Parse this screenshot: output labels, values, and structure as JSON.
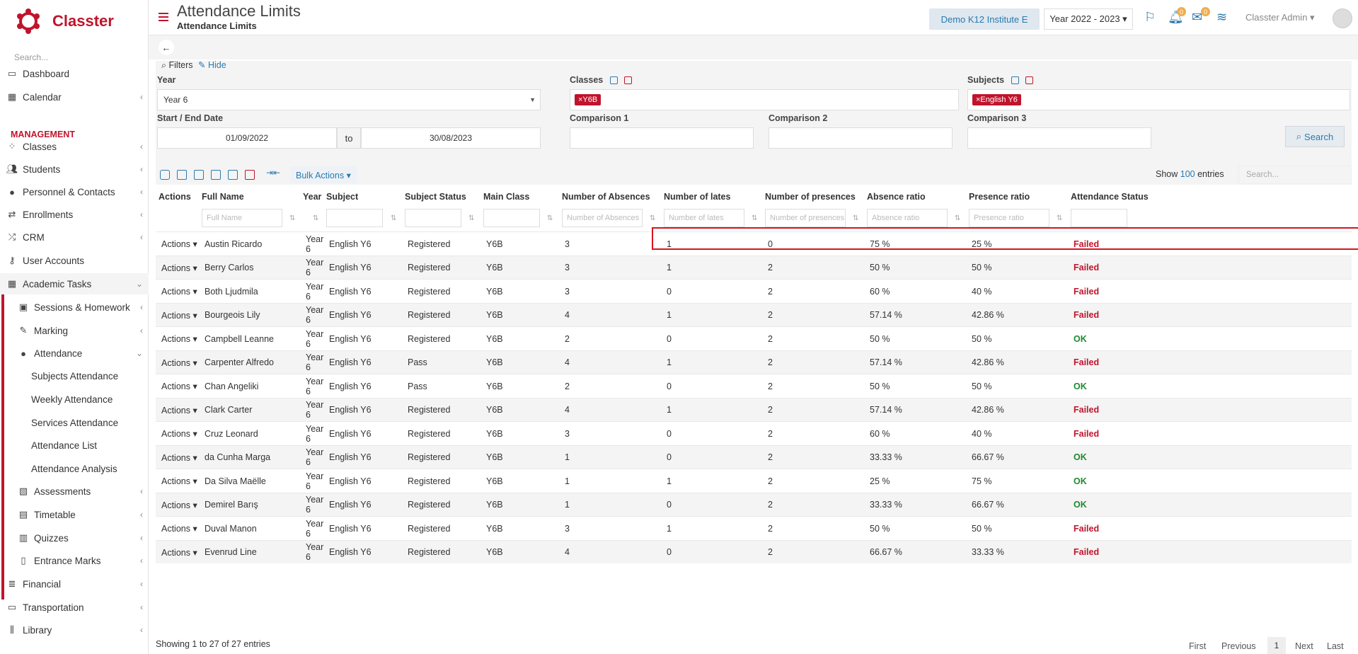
{
  "brand": {
    "name": "Classter"
  },
  "sidebar": {
    "search_placeholder": "Search...",
    "management_heading": "MANAGEMENT",
    "items": [
      {
        "label": "Dashboard",
        "icon": "laptop-icon",
        "chev": ""
      },
      {
        "label": "Calendar",
        "icon": "calendar-icon",
        "chev": "‹"
      },
      {
        "label": "Classes",
        "icon": "users-grid-icon",
        "chev": "‹"
      },
      {
        "label": "Students",
        "icon": "users-icon",
        "chev": "‹"
      },
      {
        "label": "Personnel & Contacts",
        "icon": "user-icon",
        "chev": "‹"
      },
      {
        "label": "Enrollments",
        "icon": "exchange-icon",
        "chev": "‹"
      },
      {
        "label": "CRM",
        "icon": "shuffle-icon",
        "chev": "‹"
      },
      {
        "label": "User Accounts",
        "icon": "key-icon",
        "chev": ""
      },
      {
        "label": "Academic Tasks",
        "icon": "grid-icon",
        "chev": "⌄"
      },
      {
        "label": "Sessions & Homework",
        "icon": "presentation-icon",
        "chev": "‹"
      },
      {
        "label": "Marking",
        "icon": "edit-icon",
        "chev": "‹"
      },
      {
        "label": "Attendance",
        "icon": "user-check-icon",
        "chev": "⌄"
      },
      {
        "label": "Subjects Attendance",
        "icon": "",
        "chev": ""
      },
      {
        "label": "Weekly Attendance",
        "icon": "",
        "chev": ""
      },
      {
        "label": "Services Attendance",
        "icon": "",
        "chev": ""
      },
      {
        "label": "Attendance List",
        "icon": "",
        "chev": ""
      },
      {
        "label": "Attendance Analysis",
        "icon": "",
        "chev": ""
      },
      {
        "label": "Assessments",
        "icon": "assessment-icon",
        "chev": "‹"
      },
      {
        "label": "Timetable",
        "icon": "timetable-icon",
        "chev": "‹"
      },
      {
        "label": "Quizzes",
        "icon": "quiz-icon",
        "chev": "‹"
      },
      {
        "label": "Entrance Marks",
        "icon": "clipboard-icon",
        "chev": "‹"
      },
      {
        "label": "Financial",
        "icon": "coins-icon",
        "chev": "‹"
      },
      {
        "label": "Transportation",
        "icon": "bus-icon",
        "chev": "‹"
      },
      {
        "label": "Library",
        "icon": "library-icon",
        "chev": "‹"
      }
    ]
  },
  "header": {
    "title": "Attendance Limits",
    "subtitle": "Attendance Limits",
    "institute": "Demo K12 Institute E",
    "year": "Year 2022 - 2023 ▾",
    "notif_count": "0",
    "mail_count": "0",
    "user": "Classter Admin ▾"
  },
  "filters": {
    "label": "Filters",
    "hide": "Hide",
    "year_label": "Year",
    "year_value": "Year 6",
    "classes_label": "Classes",
    "classes_tag": "×Y6B",
    "subjects_label": "Subjects",
    "subjects_tag": "×English Y6",
    "date_label": "Start / End Date",
    "start_date": "01/09/2022",
    "to": "to",
    "end_date": "30/08/2023",
    "comp1": "Comparison 1",
    "comp2": "Comparison 2",
    "comp3": "Comparison 3",
    "search": "Search"
  },
  "toolbar": {
    "bulk": "Bulk Actions ▾",
    "show": "Show",
    "entries_count": "100",
    "entries": "entries",
    "search_placeholder": "Search..."
  },
  "table": {
    "columns": [
      "Actions",
      "Full Name",
      "Year",
      "Subject",
      "Subject Status",
      "Main Class",
      "Number of Absences",
      "Number of lates",
      "Number of presences",
      "Absence ratio",
      "Presence ratio",
      "Attendance Status"
    ],
    "filter_placeholders": {
      "name": "Full Name",
      "absences": "Number of Absences",
      "lates": "Number of lates",
      "presences": "Number of presences",
      "abs_ratio": "Absence ratio",
      "pres_ratio": "Presence ratio"
    },
    "actions_label": "Actions ▾",
    "rows": [
      {
        "name": "Austin Ricardo",
        "year1": "Year",
        "year2": "6",
        "subject": "English Y6",
        "status": "Registered",
        "class": "Y6B",
        "absences": "3",
        "lates": "1",
        "presences": "0",
        "abs_ratio": "75 %",
        "pres_ratio": "25 %",
        "att": "Failed"
      },
      {
        "name": "Berry Carlos",
        "year1": "Year",
        "year2": "6",
        "subject": "English Y6",
        "status": "Registered",
        "class": "Y6B",
        "absences": "3",
        "lates": "1",
        "presences": "2",
        "abs_ratio": "50 %",
        "pres_ratio": "50 %",
        "att": "Failed"
      },
      {
        "name": "Both Ljudmila",
        "year1": "Year",
        "year2": "6",
        "subject": "English Y6",
        "status": "Registered",
        "class": "Y6B",
        "absences": "3",
        "lates": "0",
        "presences": "2",
        "abs_ratio": "60 %",
        "pres_ratio": "40 %",
        "att": "Failed"
      },
      {
        "name": "Bourgeois Lily",
        "year1": "Year",
        "year2": "6",
        "subject": "English Y6",
        "status": "Registered",
        "class": "Y6B",
        "absences": "4",
        "lates": "1",
        "presences": "2",
        "abs_ratio": "57.14 %",
        "pres_ratio": "42.86 %",
        "att": "Failed"
      },
      {
        "name": "Campbell Leanne",
        "year1": "Year",
        "year2": "6",
        "subject": "English Y6",
        "status": "Registered",
        "class": "Y6B",
        "absences": "2",
        "lates": "0",
        "presences": "2",
        "abs_ratio": "50 %",
        "pres_ratio": "50 %",
        "att": "OK"
      },
      {
        "name": "Carpenter Alfredo",
        "year1": "Year",
        "year2": "6",
        "subject": "English Y6",
        "status": "Pass",
        "class": "Y6B",
        "absences": "4",
        "lates": "1",
        "presences": "2",
        "abs_ratio": "57.14 %",
        "pres_ratio": "42.86 %",
        "att": "Failed"
      },
      {
        "name": "Chan Angeliki",
        "year1": "Year",
        "year2": "6",
        "subject": "English Y6",
        "status": "Pass",
        "class": "Y6B",
        "absences": "2",
        "lates": "0",
        "presences": "2",
        "abs_ratio": "50 %",
        "pres_ratio": "50 %",
        "att": "OK"
      },
      {
        "name": "Clark Carter",
        "year1": "Year",
        "year2": "6",
        "subject": "English Y6",
        "status": "Registered",
        "class": "Y6B",
        "absences": "4",
        "lates": "1",
        "presences": "2",
        "abs_ratio": "57.14 %",
        "pres_ratio": "42.86 %",
        "att": "Failed"
      },
      {
        "name": "Cruz Leonard",
        "year1": "Year",
        "year2": "6",
        "subject": "English Y6",
        "status": "Registered",
        "class": "Y6B",
        "absences": "3",
        "lates": "0",
        "presences": "2",
        "abs_ratio": "60 %",
        "pres_ratio": "40 %",
        "att": "Failed"
      },
      {
        "name": "da Cunha Marga",
        "year1": "Year",
        "year2": "6",
        "subject": "English Y6",
        "status": "Registered",
        "class": "Y6B",
        "absences": "1",
        "lates": "0",
        "presences": "2",
        "abs_ratio": "33.33 %",
        "pres_ratio": "66.67 %",
        "att": "OK"
      },
      {
        "name": "Da Silva Maëlle",
        "year1": "Year",
        "year2": "6",
        "subject": "English Y6",
        "status": "Registered",
        "class": "Y6B",
        "absences": "1",
        "lates": "1",
        "presences": "2",
        "abs_ratio": "25 %",
        "pres_ratio": "75 %",
        "att": "OK"
      },
      {
        "name": "Demirel Barış",
        "year1": "Year",
        "year2": "6",
        "subject": "English Y6",
        "status": "Registered",
        "class": "Y6B",
        "absences": "1",
        "lates": "0",
        "presences": "2",
        "abs_ratio": "33.33 %",
        "pres_ratio": "66.67 %",
        "att": "OK"
      },
      {
        "name": "Duval Manon",
        "year1": "Year",
        "year2": "6",
        "subject": "English Y6",
        "status": "Registered",
        "class": "Y6B",
        "absences": "3",
        "lates": "1",
        "presences": "2",
        "abs_ratio": "50 %",
        "pres_ratio": "50 %",
        "att": "Failed"
      },
      {
        "name": "Evenrud Line",
        "year1": "Year",
        "year2": "6",
        "subject": "English Y6",
        "status": "Registered",
        "class": "Y6B",
        "absences": "4",
        "lates": "0",
        "presences": "2",
        "abs_ratio": "66.67 %",
        "pres_ratio": "33.33 %",
        "att": "Failed"
      }
    ]
  },
  "footer": {
    "info": "Showing 1 to 27 of 27 entries",
    "first": "First",
    "previous": "Previous",
    "page": "1",
    "next": "Next",
    "last": "Last"
  }
}
